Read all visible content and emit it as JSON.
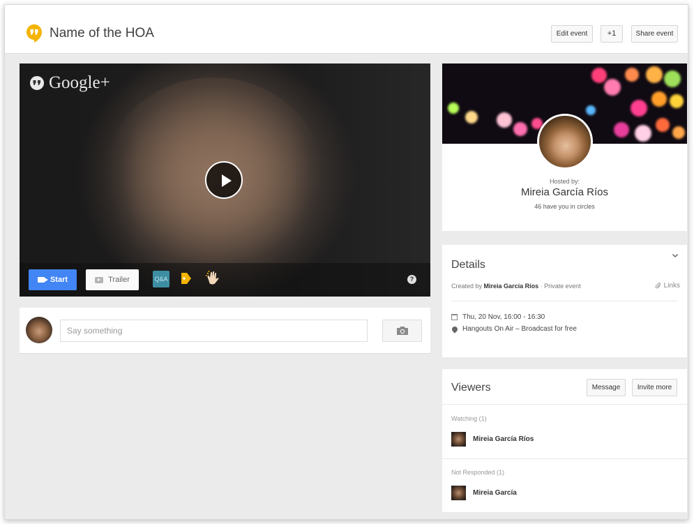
{
  "header": {
    "title": "Name of the HOA",
    "edit_label": "Edit event",
    "plusone_label": "+1",
    "share_label": "Share event"
  },
  "video": {
    "brand": "Google+",
    "start_label": "Start",
    "trailer_label": "Trailer",
    "qa_label": "Q&A",
    "help_label": "?"
  },
  "comment": {
    "placeholder": "Say something"
  },
  "host": {
    "hosted_label": "Hosted by:",
    "name": "Mireia García Ríos",
    "circles": "46 have you in circles"
  },
  "details": {
    "title": "Details",
    "created_prefix": "Created by",
    "created_by": "Mireia García Ríos",
    "privacy": "· Private event",
    "links_label": "Links",
    "date": "Thu, 20 Nov, 16:00 - 16:30",
    "location": "Hangouts On Air – Broadcast for free"
  },
  "viewers": {
    "title": "Viewers",
    "message_label": "Message",
    "invite_label": "Invite more",
    "watching_label": "Watching (1)",
    "watching_name": "Mireia García Ríos",
    "notresp_label": "Not Responded (1)",
    "notresp_name": "Mireia García"
  },
  "colors": {
    "accent": "#4285f4",
    "hangouts_yellow": "#f4b400"
  }
}
